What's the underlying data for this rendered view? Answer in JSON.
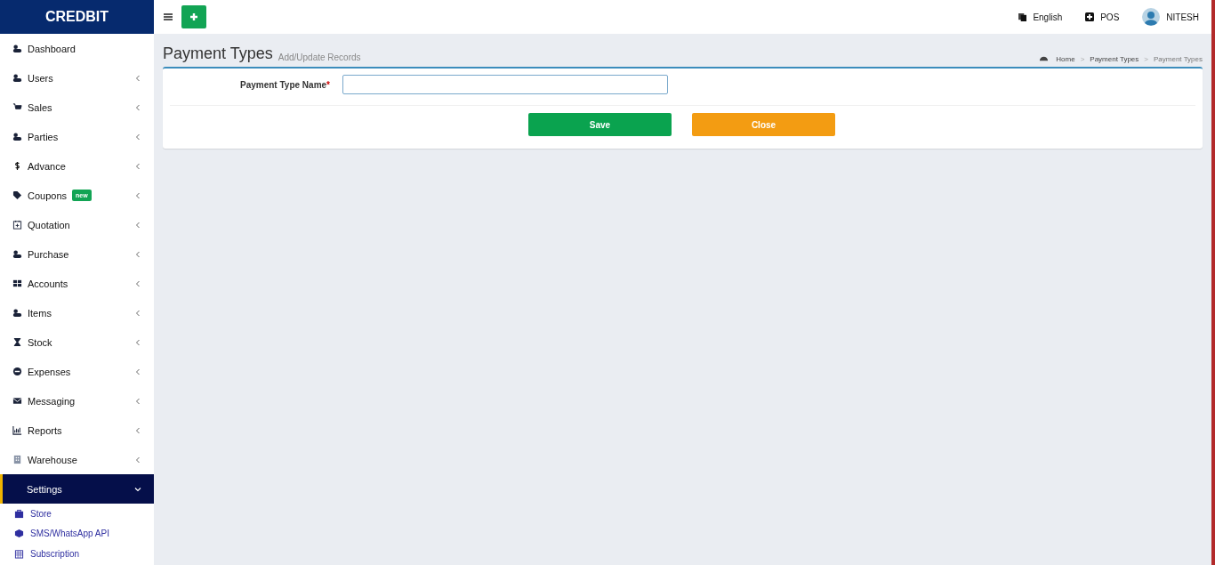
{
  "brand": "CREDBIT",
  "header": {
    "language": "English",
    "pos": "POS",
    "user": "NITESH"
  },
  "sidebar": {
    "items": [
      {
        "label": "Dashboard",
        "kind": "link",
        "selected": false
      },
      {
        "label": "Users",
        "kind": "menu",
        "selected": false,
        "expanded": false
      },
      {
        "label": "Sales",
        "kind": "menu",
        "selected": false,
        "expanded": false
      },
      {
        "label": "Parties",
        "kind": "menu",
        "selected": false,
        "expanded": false
      },
      {
        "label": "Advance",
        "kind": "menu",
        "selected": false,
        "expanded": false
      },
      {
        "label": "Coupons",
        "kind": "menu",
        "selected": false,
        "expanded": false,
        "badge": "new"
      },
      {
        "label": "Quotation",
        "kind": "menu",
        "selected": false,
        "expanded": false
      },
      {
        "label": "Purchase",
        "kind": "menu",
        "selected": false,
        "expanded": false
      },
      {
        "label": "Accounts",
        "kind": "menu",
        "selected": false,
        "expanded": false
      },
      {
        "label": "Items",
        "kind": "menu",
        "selected": false,
        "expanded": false
      },
      {
        "label": "Stock",
        "kind": "menu",
        "selected": false,
        "expanded": false
      },
      {
        "label": "Expenses",
        "kind": "menu",
        "selected": false,
        "expanded": false
      },
      {
        "label": "Messaging",
        "kind": "menu",
        "selected": false,
        "expanded": false
      },
      {
        "label": "Reports",
        "kind": "menu",
        "selected": false,
        "expanded": false
      },
      {
        "label": "Warehouse",
        "kind": "menu",
        "selected": false,
        "expanded": false
      },
      {
        "label": "Settings",
        "kind": "menu",
        "selected": true,
        "expanded": true,
        "children": [
          {
            "label": "Store"
          },
          {
            "label": "SMS/WhatsApp API"
          },
          {
            "label": "Subscription"
          }
        ]
      }
    ]
  },
  "page": {
    "title": "Payment Types",
    "subtitle": "Add/Update Records",
    "breadcrumb": [
      "Home",
      "Payment Types",
      "Payment Types"
    ],
    "breadcrumb_separator": ">"
  },
  "form": {
    "field_label": "Payment Type Name",
    "required_mark": "*",
    "buttons": [
      {
        "label": "Save",
        "kind": "save"
      },
      {
        "label": "Close",
        "kind": "close"
      }
    ]
  }
}
